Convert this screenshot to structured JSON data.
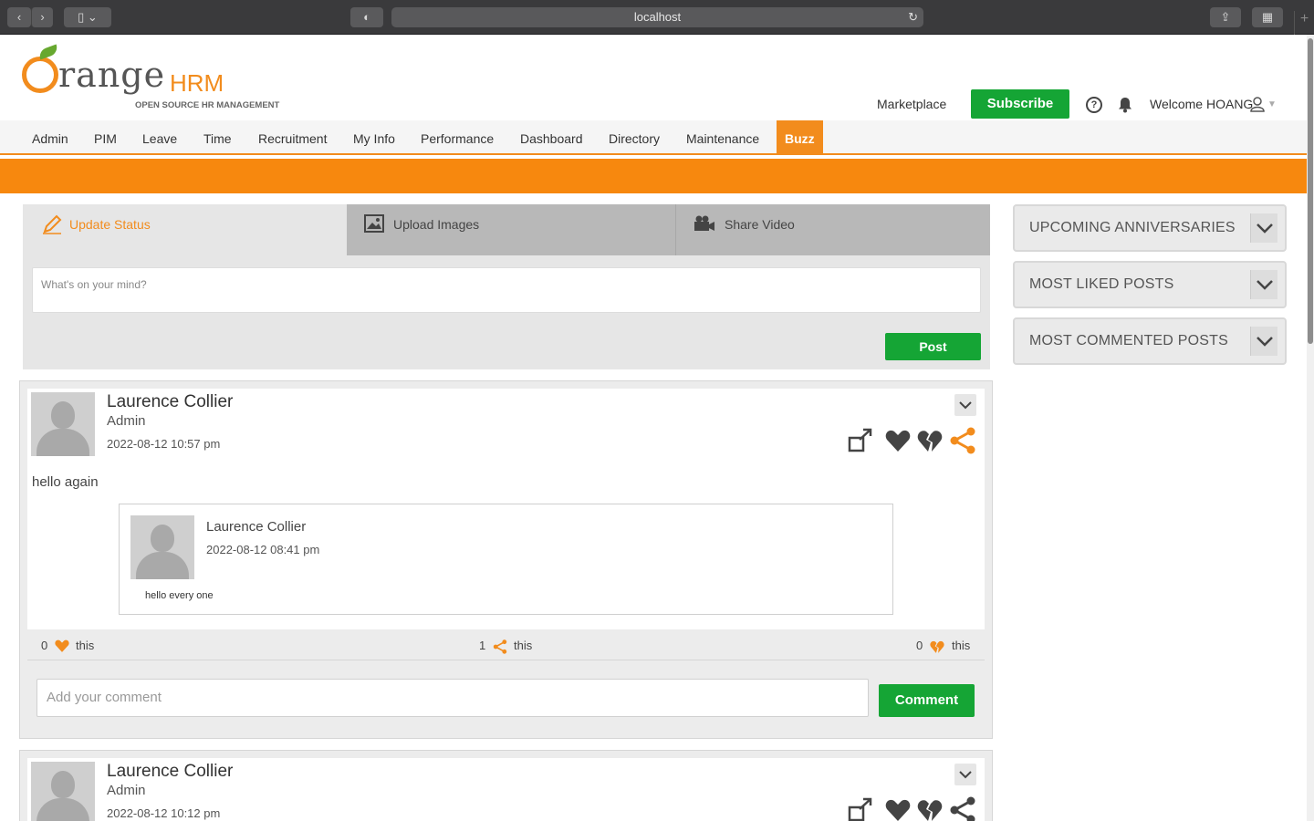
{
  "browser": {
    "url": "localhost"
  },
  "header": {
    "logo_word": "range",
    "logo_hrm": "HRM",
    "logo_tagline": "OPEN SOURCE HR MANAGEMENT",
    "marketplace": "Marketplace",
    "subscribe": "Subscribe",
    "welcome": "Welcome HOANG"
  },
  "nav": {
    "items": [
      "Admin",
      "PIM",
      "Leave",
      "Time",
      "Recruitment",
      "My Info",
      "Performance",
      "Dashboard",
      "Directory",
      "Maintenance",
      "Buzz"
    ],
    "active": "Buzz"
  },
  "composer": {
    "tabs": [
      "Update Status",
      "Upload Images",
      "Share Video"
    ],
    "placeholder": "What's on your mind?",
    "post_label": "Post"
  },
  "sidebar": {
    "widgets": [
      "UPCOMING ANNIVERSARIES",
      "MOST LIKED POSTS",
      "MOST COMMENTED POSTS"
    ]
  },
  "posts": [
    {
      "author": "Laurence Collier",
      "role": "Admin",
      "date": "2022-08-12  10:57 pm",
      "text": "hello again",
      "shared": {
        "author": "Laurence Collier",
        "date": "2022-08-12  08:41 pm",
        "text": "hello every one"
      },
      "likes": "0",
      "shares": "1",
      "dislikes": "0",
      "this_label": "this",
      "comment_placeholder": "Add your comment",
      "comment_label": "Comment"
    },
    {
      "author": "Laurence Collier",
      "role": "Admin",
      "date": "2022-08-12  10:12 pm"
    }
  ],
  "colors": {
    "orange": "#f28c1d",
    "green": "#15a535"
  }
}
